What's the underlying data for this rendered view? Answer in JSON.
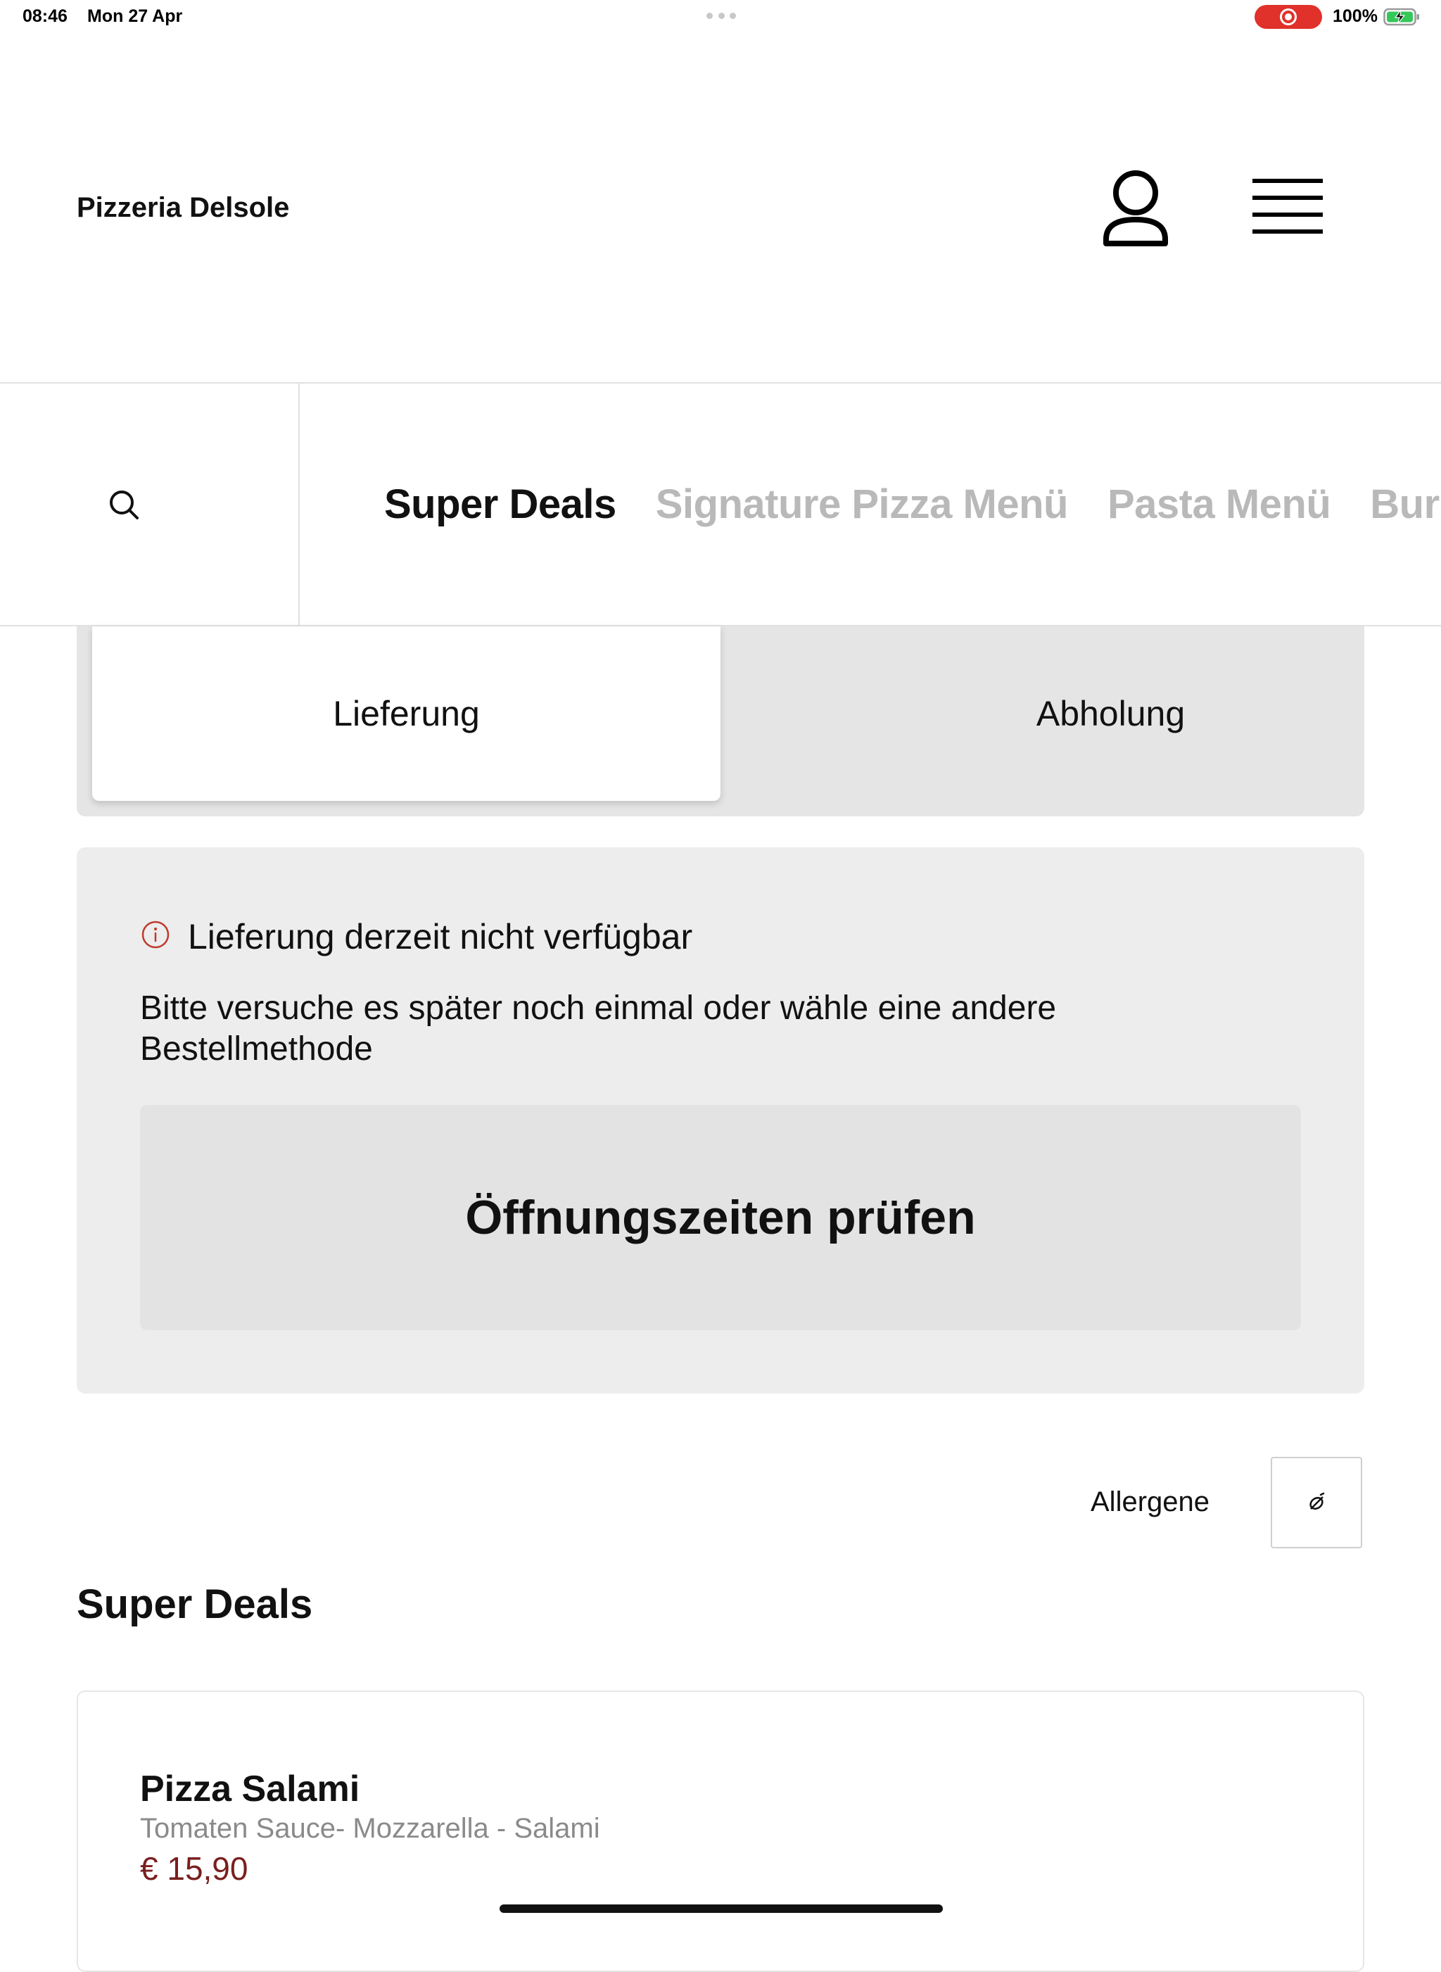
{
  "status_bar": {
    "time": "08:46",
    "date": "Mon 27 Apr",
    "battery_percent": "100%",
    "record_color": "#e0312b",
    "battery_color": "#34c759"
  },
  "header": {
    "brand": "Pizzeria Delsole",
    "account_icon": "person-icon",
    "menu_icon": "hamburger-menu-icon"
  },
  "categories": {
    "search_icon": "search-icon",
    "tabs": [
      {
        "label": "Super Deals",
        "active": true
      },
      {
        "label": "Signature Pizza Menü",
        "active": false
      },
      {
        "label": "Pasta Menü",
        "active": false
      },
      {
        "label": "Bur",
        "active": false
      }
    ]
  },
  "order_method": {
    "options": [
      "Lieferung",
      "Abholung"
    ],
    "selected": "Lieferung"
  },
  "notice": {
    "icon": "info-icon",
    "icon_color": "#c0392b",
    "title": "Lieferung derzeit nicht verfügbar",
    "message": "Bitte versuche es später noch einmal oder wähle eine andere Bestellmethode",
    "button_label": "Öffnungszeiten prüfen"
  },
  "allergens": {
    "label": "Allergene",
    "icon": "allergen-filter-icon"
  },
  "section": {
    "title": "Super Deals"
  },
  "products": [
    {
      "name": "Pizza Salami",
      "description": "Tomaten Sauce- Mozzarella - Salami",
      "price": "€ 15,90"
    }
  ]
}
